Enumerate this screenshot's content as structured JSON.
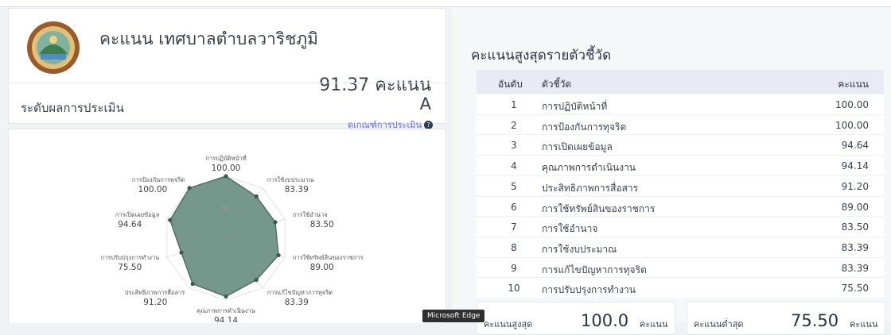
{
  "header": {
    "title": "คะแนน เทศบาลตำบลวาริชภูมิ",
    "score_text": "91.37 คะแนน",
    "level_label": "ระดับผลการประเมิน",
    "grade": "A",
    "criteria_link": "ดูเกณฑ์การประเมิน"
  },
  "chart_data": {
    "type": "radar",
    "title": "",
    "rmax": 100,
    "tick_labels": [
      "50",
      "0"
    ],
    "fill_color": "#6f9186",
    "categories": [
      "การปฏิบัติหน้าที่",
      "การใช้งบประมาณ",
      "การใช้อำนาจ",
      "การใช้ทรัพย์สินของราชการ",
      "การแก้ไขปัญหาการทุจริต",
      "คุณภาพการดำเนินงาน",
      "ประสิทธิภาพการสื่อสาร",
      "การปรับปรุงการทำงาน",
      "การเปิดเผยข้อมูล",
      "การป้องกันการทุจริต"
    ],
    "values": [
      100.0,
      83.39,
      83.5,
      89.0,
      83.39,
      94.14,
      91.2,
      75.5,
      94.64,
      100.0
    ],
    "value_labels": [
      "100.00",
      "83.39",
      "83.50",
      "89.00",
      "83.39",
      "94.14",
      "91.20",
      "75.50",
      "94.64",
      "100.00"
    ]
  },
  "ranking": {
    "title": "คะแนนสูงสุดรายตัวชี้วัด",
    "headers": {
      "rank": "อันดับ",
      "indicator": "ตัวชี้วัด",
      "score": "คะแนน"
    },
    "rows": [
      {
        "rank": "1",
        "indicator": "การปฏิบัติหน้าที่",
        "score": "100.00"
      },
      {
        "rank": "2",
        "indicator": "การป้องกันการทุจริต",
        "score": "100.00"
      },
      {
        "rank": "3",
        "indicator": "การเปิดเผยข้อมูล",
        "score": "94.64"
      },
      {
        "rank": "4",
        "indicator": "คุณภาพการดำเนินงาน",
        "score": "94.14"
      },
      {
        "rank": "5",
        "indicator": "ประสิทธิภาพการสื่อสาร",
        "score": "91.20"
      },
      {
        "rank": "6",
        "indicator": "การใช้ทรัพย์สินของราชการ",
        "score": "89.00"
      },
      {
        "rank": "7",
        "indicator": "การใช้อำนาจ",
        "score": "83.50"
      },
      {
        "rank": "8",
        "indicator": "การใช้งบประมาณ",
        "score": "83.39"
      },
      {
        "rank": "9",
        "indicator": "การแก้ไขปัญหาการทุจริต",
        "score": "83.39"
      },
      {
        "rank": "10",
        "indicator": "การปรับปรุงการทำงาน",
        "score": "75.50"
      }
    ]
  },
  "summary": {
    "max_label": "คะแนนสูงสุด",
    "max_value": "100.0",
    "max_unit": "คะแนน",
    "min_label": "คะแนนต่ำสุด",
    "min_value": "75.50",
    "min_unit": "คะแนน"
  },
  "tooltip": {
    "text": "Microsoft Edge"
  }
}
